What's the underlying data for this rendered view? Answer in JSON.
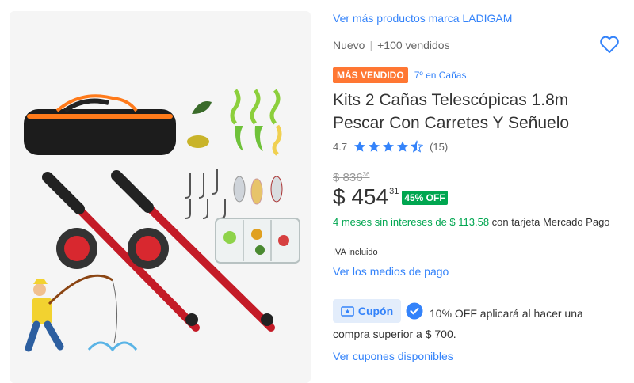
{
  "product": {
    "brand_link": "Ver más productos marca LADIGAM",
    "condition": "Nuevo",
    "sold": "+100 vendidos",
    "badge_best_seller": "MÁS VENDIDO",
    "badge_rank": "7º en Cañas",
    "title": "Kits 2 Cañas Telescópicas 1.8m Pescar Con Carretes Y Señuelo",
    "rating_value": "4.7",
    "rating_stars": 4.7,
    "rating_count": "(15)",
    "old_price": "$ 836",
    "old_price_cents": "36",
    "price": "$ 454",
    "price_cents": "31",
    "discount": "45% OFF",
    "installments_green": "4 meses sin intereses de $ 113.58",
    "installments_rest": " con tarjeta Mercado Pago",
    "iva": "IVA incluido",
    "payment_link": "Ver los medios de pago",
    "coupon_label": "Cupón",
    "coupon_text": "10% OFF aplicará al hacer una compra superior a $ 700.",
    "coupons_link": "Ver cupones disponibles"
  },
  "icons": {
    "heart": "heart-icon",
    "star": "star-icon",
    "coupon": "coupon-icon",
    "check": "check-badge-icon"
  },
  "colors": {
    "link": "#3483fa",
    "best_seller": "#ff7733",
    "discount": "#00a650",
    "rod": "#d01f2a"
  }
}
